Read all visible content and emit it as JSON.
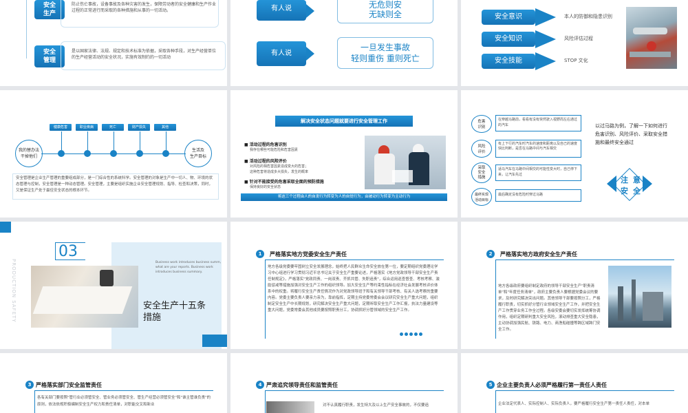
{
  "s1": {
    "box1": "安全\n生产",
    "text1": "防止伤亡事故，设备事故及各种灾害的发生，保障劳动者的安全健康和生产作业过程的正常进行而采取的各种措施和从事的一切活动。",
    "box2": "安全\n管理",
    "text2": "是以国家法律、法规、规定和技术标准为依据，采取各种手段，对生产经营单位的生产经营活动的安全状况，实施有效制约的一切活动"
  },
  "s2": {
    "label1": "有人说",
    "quote1a": "无危则安",
    "quote1b": "无缺则全",
    "label2": "有人说",
    "quote2a": "一旦发生事故",
    "quote2b": "轻则重伤 重则死亡"
  },
  "s3": {
    "items": [
      {
        "label": "安全意识",
        "desc": "本人的防御和隐患识别"
      },
      {
        "label": "安全知识",
        "desc": "风险评估过程"
      },
      {
        "label": "安全技能",
        "desc": "STOP 文化"
      }
    ]
  },
  "s4": {
    "tags": [
      "健康危害",
      "职业疾病",
      "死亡",
      "财产损失",
      "其他"
    ],
    "left": "我的替办法\n干掉他们",
    "right": "生活及\n生产目标",
    "body": "安全管理是企业生产管理的重要组成部分，是一门综合性的系统科学。安全管理的对象是生产中一切人、物、环境的状态管理与控制，安全管理是一种动态管理。安全管理，主要是组织实施企业安全管理规划、指导、检查和决策，同时，又是保证生产处于最佳安全状态的根本环节。"
  },
  "s5": {
    "banner": "解决安全状态问题就要进行安全管理工作",
    "b1": "活动过程的危害识别",
    "b1s": "我存在哪些可能危险和危害因素",
    "b2": "活动过程的风险评价",
    "b2s": "对风险的相危害因素造成变大的危害；\n这种危害将造成多大损失，发生的概率",
    "b3": "针对不能接受的危害采取全面的预防措施",
    "b3s": "保持良好的安全状态",
    "footer": "将这三个过程由人的自发行为转变为人的自觉行为，由被动行为转变为主动行为"
  },
  "s6": {
    "rows": [
      {
        "tag": "危害\n识别",
        "text": "在穿越马路前，看看有没有突然驶入视野而左右通过的汽车"
      },
      {
        "tag": "风险\n评价",
        "text": "有上下行的汽车时汽车的速度和距离以及自己的速度快比判断，是否在马路中间与汽车相交"
      },
      {
        "tag": "采取\n安全\n措施",
        "text": "适马汽车在马路中间相交的可能性变大时，自己停下来，让汽车先过"
      },
      {
        "tag": "最终实现\n活动目标",
        "text": "最后确定没有危险时穿过马路"
      }
    ],
    "intro": "以过马路为例，了解一下如何进行危害识别、风险评价、采取安全措施和最终安全通过",
    "d1": "注",
    "d2": "意",
    "d3": "安",
    "d4": "全"
  },
  "s7": {
    "vertical": "PRODUCTION SAFETY",
    "num": "03",
    "en": "Business work introduces business summ, what are your reports. Business work introduces business summary.",
    "title1": "安全生产十五条",
    "title2": "措施"
  },
  "s8": {
    "num": "1",
    "title": "严格落实地方党委安全生产责任",
    "body": "地方各级党委要牢固树立安全发展理念，始终把人民群众生命安全放在第一位，要定期组织党委理论学习中心组进行学习贯彻习近平总书记关于安全生产重要论述，严格落实《地方党政领导干部安全生产责任制规定》，严格落实\"党政同责、一岗双责、齐抓共管、失职追责\"，综合运用巡查督查、考核考察、激励惩戒等措施加强对安全生产工作的组织领导。加大安全生产等约束性指标在经济社会发展考核评价体系中的权重。将履行安全生产责任情况作为对党政领导班子和有关领导干部考核、有关人选考察的重要内容。党委主要负责人要亲力亲为，靠前指挥，定期主持党委常委会会议研究安全生产重大问题，组织制定安全生产中长期规划，研究解决安全生产重大问题，定期听取安全生产工作汇报，执法力量建设等重大问题，党委常委会其他成员要按照职责分工，协调抓好分管领域的安全生产工作。"
  },
  "s9": {
    "num": "2",
    "title": "严格落实地方政府安全生产责任",
    "body": "地方各级政府要组织制定政府的领导干部安全生产\"职责清单\"和\"年度任务清单\"，政府主要负责人要根据党委会议的要求，及时研究解决突出问题。其他领导干部要按照分工，严格履行职责，切实抓好分管行业领域安全生产工作，并把安全生产工作贯穿业务工作全过程。各级安委会要切实发挥统筹协调作用，组织定期研判重大安全风险，滚动排查重大安全隐患，主动协调加强民航、铁路、电力、商渔船碰撞等跨区域跨门安全工作。"
  },
  "s10": {
    "num": "3",
    "title": "严格落实部门安全监管责任",
    "body": "各有关部门要按照\"管行业必须管安全、管业务必须管安全、管生产经营必须管安全\"和\"谁主管谁负责\"的原则，依法依规积极编制安全生产权力和责任清单，对职能交叉和新业"
  },
  "s11": {
    "num": "4",
    "title": "严肃追究领导责任和监管责任",
    "body": "对不认真履行职责，发生特大及以上生产安全事故的，不仅要追"
  },
  "s12": {
    "num": "5",
    "title": "企业主要负责人必须严格履行第一责任人责任",
    "body": "企业法定代表人、实际控制人、实际负责人，要严格履行安全生产第一责任人责任，对本单"
  },
  "colors": {
    "accent": "#1a83c6",
    "dark": "#1264a3",
    "bg": "#e4e6ea"
  }
}
